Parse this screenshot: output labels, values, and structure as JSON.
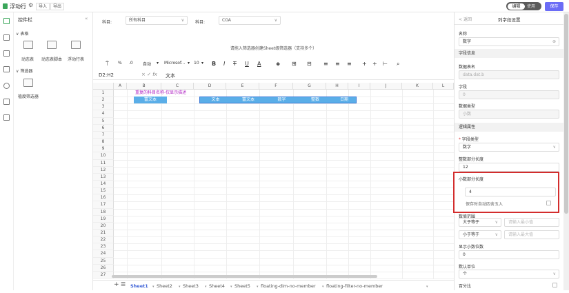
{
  "topbar": {
    "app_title": "浮动行",
    "import_label": "导入",
    "export_label": "导出",
    "mode_edit": "编辑",
    "mode_use": "使用",
    "save_label": "保存"
  },
  "controls_panel": {
    "title": "控件栏",
    "collapse_icon": "double-chevron-left-icon",
    "table_section": "表格",
    "table_items": [
      "动态表",
      "动态表脚本",
      "浮动行表"
    ],
    "filter_section": "筛选器",
    "filter_items": [
      "植度筛选器"
    ]
  },
  "filters": {
    "subject_label": "科目:",
    "subject_value": "所有科目",
    "subject2_label": "科目:",
    "subject2_value": "COA"
  },
  "sheet": {
    "hint": "请拖入筛选器创建Sheet级筛选器（支持多个）",
    "toolbar": {
      "zoom": "自动",
      "font": "Microsof...",
      "size": "10"
    },
    "cell_ref": "D2:H2",
    "formula_value": "文本",
    "columns": [
      "A",
      "B",
      "C",
      "D",
      "E",
      "F",
      "G",
      "H",
      "I",
      "J",
      "K",
      "L"
    ],
    "rows": [
      "1",
      "2",
      "3",
      "4",
      "5",
      "6",
      "7",
      "8",
      "9",
      "10",
      "11",
      "12",
      "13",
      "14",
      "15",
      "16",
      "17",
      "18",
      "19",
      "20",
      "21",
      "22",
      "23",
      "24",
      "25",
      "26",
      "27"
    ],
    "b1_text": "重复的科目名称-仅显示描述",
    "b2_text": "富文本",
    "row2_cells": [
      "文本",
      "富文本",
      "数字",
      "整数",
      "日期"
    ],
    "tabs": [
      "Sheet1",
      "Sheet2",
      "Sheet3",
      "Sheet4",
      "Sheet5",
      "floating-dim-no-member",
      "floating-filter-no-member"
    ],
    "active_tab": "Sheet1"
  },
  "props": {
    "back": "返回",
    "title": "列字段设置",
    "name_label": "名称",
    "name_value": "数字",
    "field_info": "字段信息",
    "table_name_label": "数据表名",
    "table_name_value": "data.dat.b",
    "field_label": "字段",
    "field_value": "0",
    "data_type_label": "数据类型",
    "data_type_value": "小数",
    "logic_section": "逻辑属性",
    "field_type_label": "字段类型",
    "field_type_value": "数字",
    "int_len_label": "整数部分长度",
    "int_len_value": "12",
    "dec_len_label": "小数部分长度",
    "dec_len_value": "4",
    "round_label": "保存时自动四舍五入",
    "range_label": "数值范围",
    "gte_label": "大于等于",
    "min_placeholder": "请输入最小值",
    "lte_label": "小于等于",
    "max_placeholder": "请输入最大值",
    "display_dec_label": "显示小数位数",
    "display_dec_value": "0",
    "unit_label": "默认单位",
    "unit_value": "个",
    "percent_label": "百分比"
  }
}
